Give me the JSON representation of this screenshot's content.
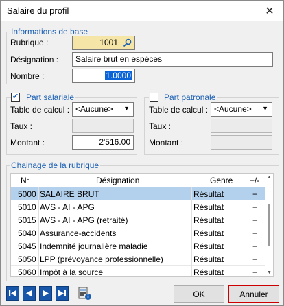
{
  "window": {
    "title": "Salaire du profil"
  },
  "info": {
    "legend": "Informations de base",
    "rubrique_label": "Rubrique :",
    "rubrique_value": "1001",
    "designation_label": "Désignation :",
    "designation_value": "Salaire brut en espèces",
    "nombre_label": "Nombre :",
    "nombre_value": "1.0000"
  },
  "salariale": {
    "legend": "Part salariale",
    "checked": true,
    "table_label": "Table de calcul :",
    "table_value": "<Aucune>",
    "taux_label": "Taux :",
    "taux_value": "",
    "montant_label": "Montant :",
    "montant_value": "2'516.00"
  },
  "patronale": {
    "legend": "Part patronale",
    "checked": false,
    "table_label": "Table de calcul :",
    "table_value": "<Aucune>",
    "taux_label": "Taux :",
    "taux_value": "",
    "montant_label": "Montant :",
    "montant_value": ""
  },
  "chainage": {
    "legend": "Chainage de la rubrique",
    "columns": [
      "N°",
      "Désignation",
      "Genre",
      "+/-"
    ],
    "rows": [
      {
        "no": "5000",
        "designation": "SALAIRE BRUT",
        "genre": "Résultat",
        "sign": "+"
      },
      {
        "no": "5010",
        "designation": "AVS - AI - APG",
        "genre": "Résultat",
        "sign": "+"
      },
      {
        "no": "5015",
        "designation": "AVS - AI - APG (retraité)",
        "genre": "Résultat",
        "sign": "+"
      },
      {
        "no": "5040",
        "designation": "Assurance-accidents",
        "genre": "Résultat",
        "sign": "+"
      },
      {
        "no": "5045",
        "designation": "Indemnité journalière maladie",
        "genre": "Résultat",
        "sign": "+"
      },
      {
        "no": "5050",
        "designation": "LPP (prévoyance professionnelle)",
        "genre": "Résultat",
        "sign": "+"
      },
      {
        "no": "5060",
        "designation": "Impôt à la source",
        "genre": "Résultat",
        "sign": "+"
      }
    ],
    "selected_row": 0
  },
  "footer": {
    "nav_icons": [
      "first-record-icon",
      "previous-record-icon",
      "next-record-icon",
      "last-record-icon"
    ],
    "calc_icon": "calculator-info-icon",
    "ok_label": "OK",
    "cancel_label": "Annuler"
  },
  "colors": {
    "legend_blue": "#1a5fb4",
    "selected_row": "#b3d1ec",
    "rubrique_bg": "#f5e6a8",
    "nav_blue": "#1756a9",
    "cancel_border": "#cc0000"
  }
}
